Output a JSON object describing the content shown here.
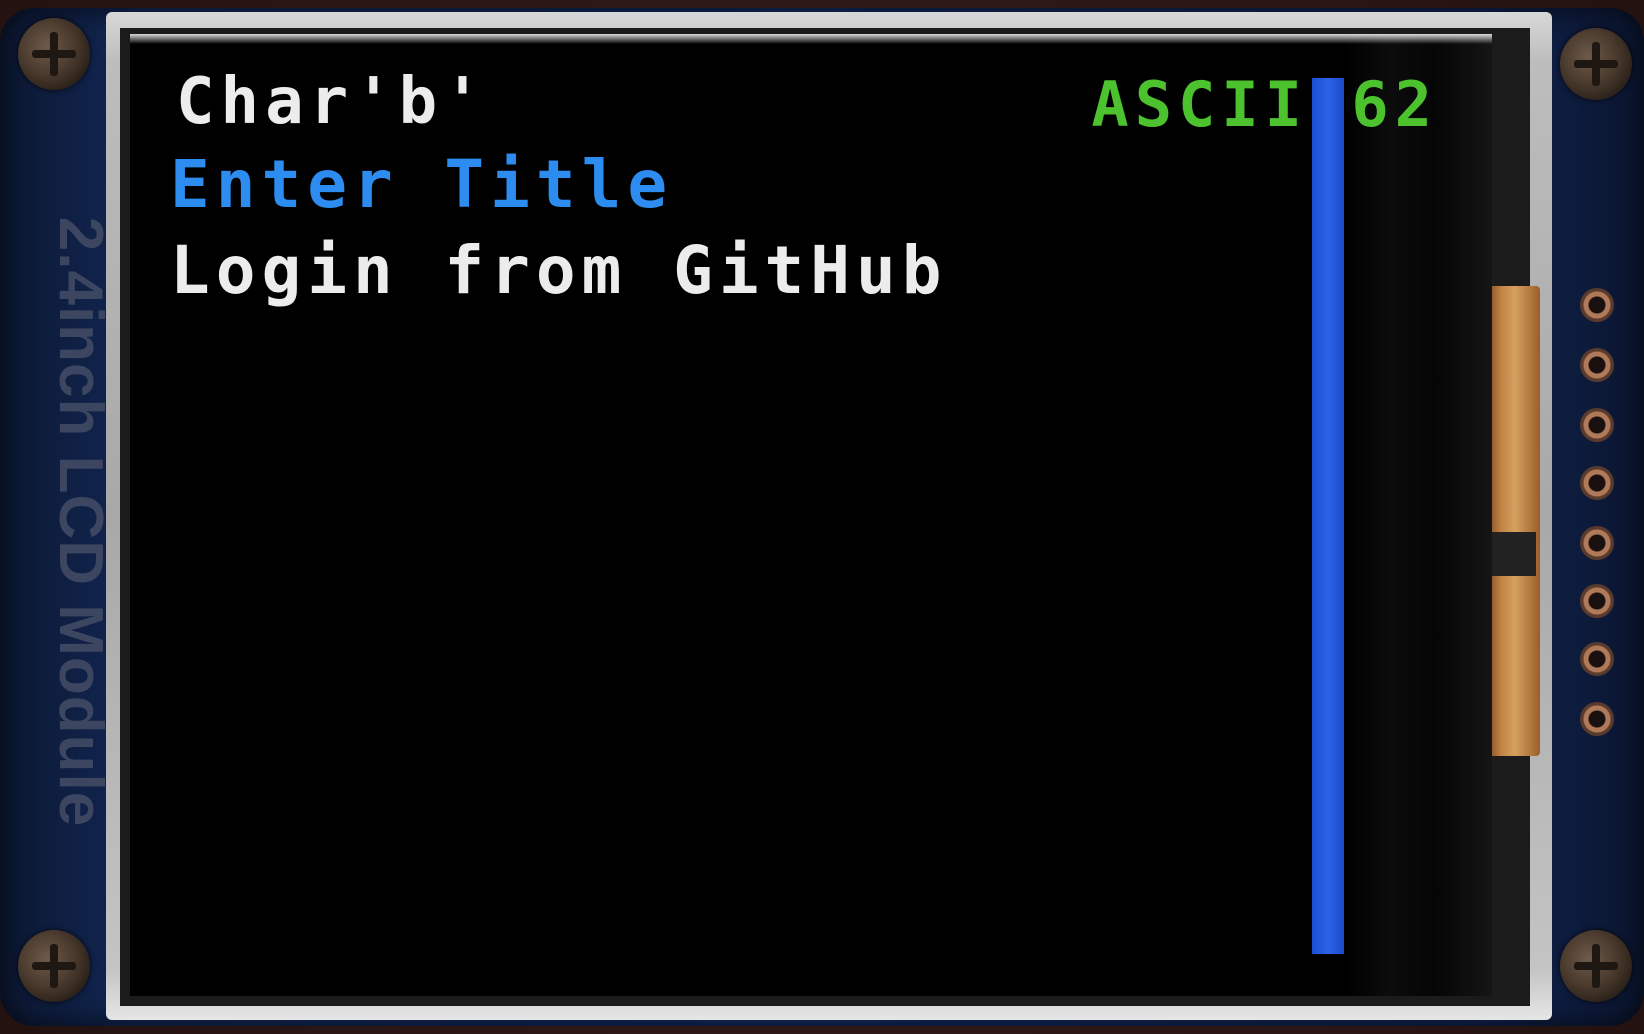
{
  "device": {
    "board_label": "2.4inch LCD Module"
  },
  "screen": {
    "char_line": "Char'b'",
    "ascii_line": "ASCII:62",
    "title_line": "Enter Title",
    "login_line": "Login from GitHub",
    "scrollbar_fraction": 1.0
  },
  "colors": {
    "screen_background": "#000000",
    "char_text": "#ececec",
    "ascii_text": "#4cc22e",
    "title_text": "#2c8cf0",
    "login_text": "#ececec",
    "scrollbar": "#2a62e8"
  }
}
